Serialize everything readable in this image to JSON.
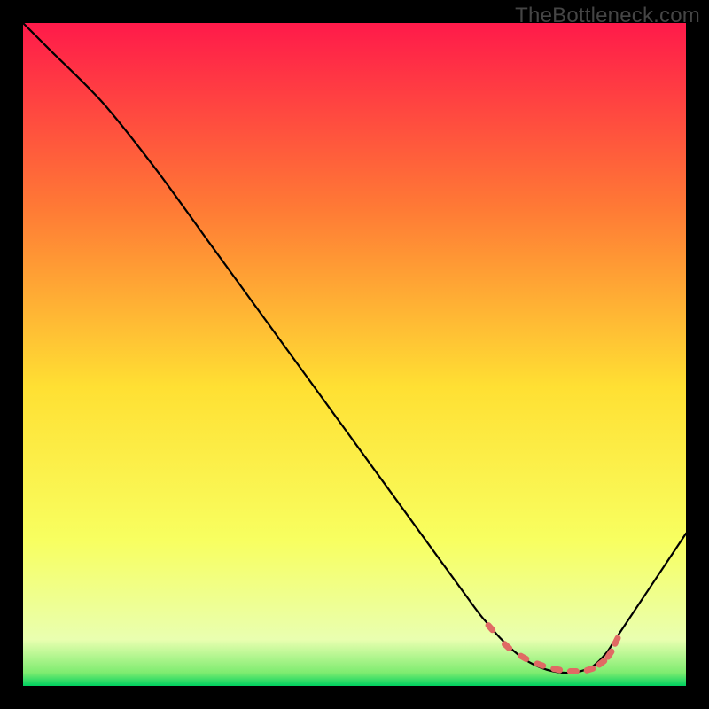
{
  "watermark": "TheBottleneck.com",
  "chart_data": {
    "type": "line",
    "title": "",
    "xlabel": "",
    "ylabel": "",
    "xlim": [
      0,
      100
    ],
    "ylim": [
      0,
      100
    ],
    "grid": false,
    "legend": false,
    "background_gradient": {
      "top": "#ff1a4a",
      "upper_mid": "#ff9a30",
      "mid": "#ffe033",
      "lower_mid": "#f8ff60",
      "bottom": "#00d060"
    },
    "series": [
      {
        "name": "curve",
        "color": "#000000",
        "x": [
          0,
          4,
          12,
          20,
          28,
          36,
          44,
          52,
          60,
          68,
          70,
          72,
          74,
          76,
          78,
          80,
          82,
          84,
          86,
          88,
          90,
          100
        ],
        "y": [
          100,
          96,
          88,
          78,
          67,
          56,
          45,
          34,
          23,
          12,
          9.5,
          7.2,
          5.3,
          3.8,
          2.8,
          2.2,
          2.0,
          2.2,
          3.0,
          5.0,
          8.0,
          23
        ]
      }
    ],
    "markers": {
      "name": "red-dashes",
      "color": "#e06a64",
      "style": "dash",
      "x": [
        70.5,
        73.0,
        75.5,
        78.0,
        80.5,
        83.0,
        85.5,
        87.3,
        88.5,
        89.5
      ],
      "y": [
        8.8,
        6.0,
        4.3,
        3.2,
        2.5,
        2.2,
        2.5,
        3.5,
        4.8,
        6.8
      ]
    }
  }
}
